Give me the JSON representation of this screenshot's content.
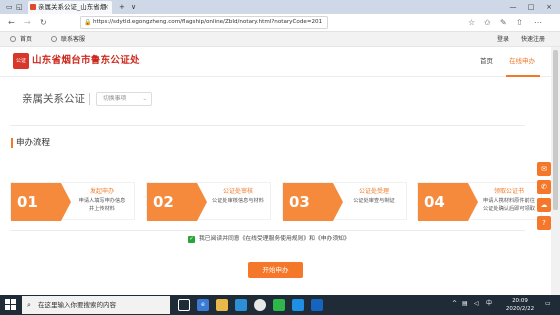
{
  "browser": {
    "tab_title": "亲属关系公证_山东省烟",
    "tab_close": "×",
    "new_tab": "+",
    "tab_menu": "∨",
    "back": "←",
    "forward": "→",
    "refresh": "↻",
    "url": "https://sdytld.egongzheng.com/flagship/online/ZbId/notary.html?notaryCode=201",
    "bookmarks": [
      "首页",
      "联系客服"
    ],
    "right_links": [
      "登录",
      "快速注册"
    ],
    "win_min": "—",
    "win_max": "□",
    "win_close": "×"
  },
  "site": {
    "logo_text": "公证",
    "title": "山东省烟台市鲁东公证处",
    "nav": [
      "首页",
      "在线申办"
    ],
    "accent": "#f5782a"
  },
  "main": {
    "page_title": "亲属关系公证",
    "switch_label": "切换事项",
    "switch_arrow": "⌄",
    "section_title": "申办流程",
    "steps": [
      {
        "num": "01",
        "title": "发起申办",
        "desc1": "申请人填写申办信息",
        "desc2": "并上传材料"
      },
      {
        "num": "02",
        "title": "公证处审核",
        "desc1": "公证处审核信息与材料",
        "desc2": ""
      },
      {
        "num": "03",
        "title": "公证处受理",
        "desc1": "公证处审查与制证",
        "desc2": ""
      },
      {
        "num": "04",
        "title": "领取公证书",
        "desc1": "申请人携材料原件前往",
        "desc2": "公证处确认后即可领取"
      }
    ],
    "agreement": "我已阅读并同意《在线受理服务使用规则》和《申办须知》",
    "check": "✓",
    "start_button": "开始申办"
  },
  "side_icons": [
    "✉",
    "✆",
    "☁",
    "?"
  ],
  "taskbar": {
    "search_placeholder": "在这里输入你要搜索的内容",
    "time": "20:09",
    "date": "2020/2/22",
    "ime": "中"
  }
}
